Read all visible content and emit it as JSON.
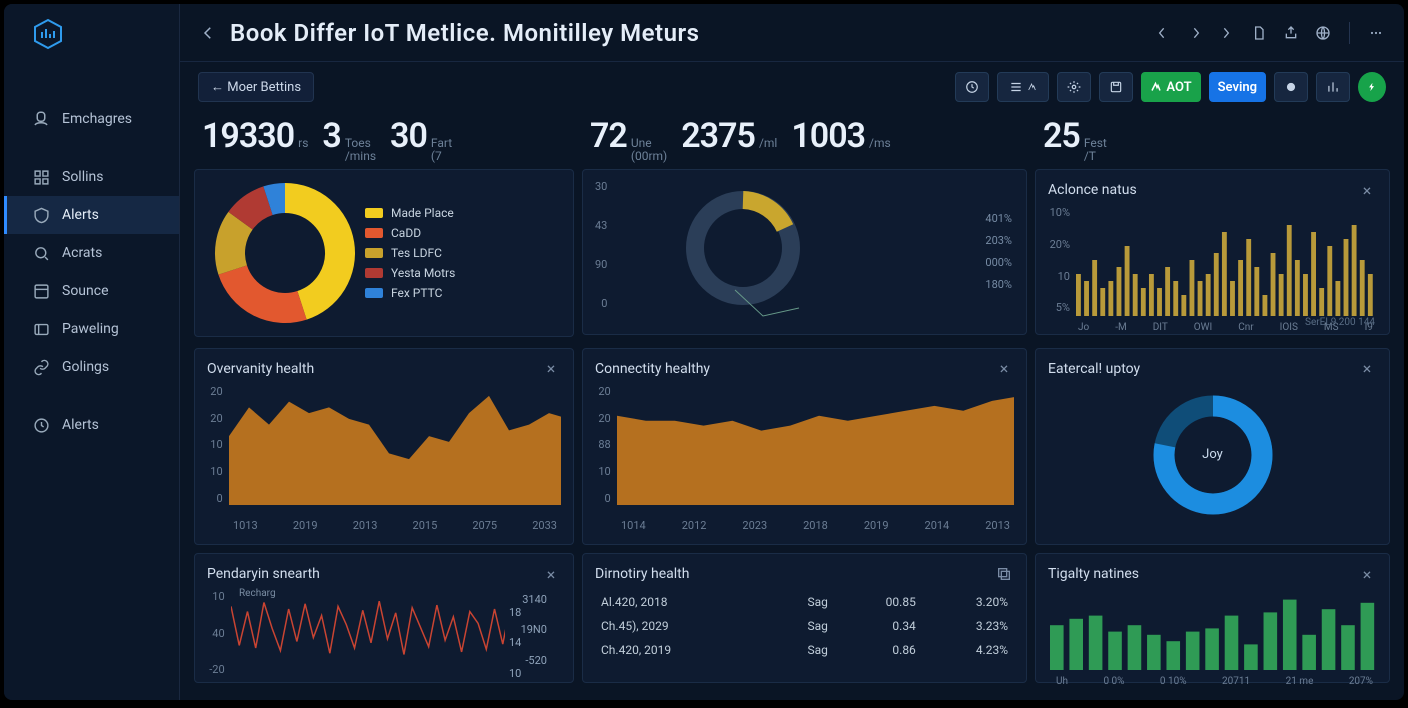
{
  "title": "Book Differ IoT Metlice. Monitilley Meturs",
  "crumb": "← Moer Bettins",
  "sidebar": {
    "header": "Emchagres",
    "items": [
      "Sollins",
      "Alerts",
      "Acrats",
      "Sounce",
      "Paweling",
      "Golings",
      "Alerts"
    ],
    "active": 1
  },
  "toolbar": {
    "btn_green": "AOT",
    "btn_blue": "Seving"
  },
  "kpi_left": [
    {
      "v": "19330",
      "u": "rs"
    },
    {
      "v": "3",
      "u1": "Toes",
      "u2": "/mins"
    },
    {
      "v": "30",
      "u1": "Fart",
      "u2": "(7"
    }
  ],
  "kpi_mid": [
    {
      "v": "72",
      "u1": "Une",
      "u2": "(00rm)"
    },
    {
      "v": "2375",
      "u": "/ml"
    },
    {
      "v": "1003",
      "u": "/ms"
    }
  ],
  "kpi_right": [
    {
      "v": "25",
      "u1": "Fest",
      "u2": "/T"
    }
  ],
  "donut1": {
    "legend": [
      {
        "label": "Made Place",
        "color": "#f2cc1f"
      },
      {
        "label": "CaDD",
        "color": "#e2582f"
      },
      {
        "label": "Tes LDFC",
        "color": "#c8a12c"
      },
      {
        "label": "Yesta Motrs",
        "color": "#b03a33"
      },
      {
        "label": "Fex PTTC",
        "color": "#2f82d9"
      }
    ],
    "slices": [
      45,
      25,
      15,
      10,
      5
    ]
  },
  "mid_chart": {
    "y": [
      "30",
      "43",
      "90",
      "0"
    ],
    "stats": [
      "401%",
      "203%",
      "000%",
      "180%"
    ]
  },
  "chart_data": [
    {
      "id": "overvanity",
      "type": "area",
      "title": "Overvanity health",
      "y_ticks": [
        20,
        20,
        10,
        10,
        0
      ],
      "x_ticks": [
        "1013",
        "2019",
        "2013",
        "2015",
        "2075",
        "2033"
      ],
      "values": [
        12,
        17,
        14,
        18,
        16,
        17,
        15,
        14,
        9,
        8,
        12,
        11,
        16,
        19,
        13,
        14,
        16,
        15
      ]
    },
    {
      "id": "connectity",
      "type": "area",
      "title": "Connectity healthy",
      "y_ticks": [
        20,
        20,
        "88",
        10,
        0
      ],
      "x_ticks": [
        "1014",
        "2012",
        "2023",
        "2018",
        "2019",
        "2014",
        "2013"
      ],
      "values": [
        18,
        17,
        17,
        16,
        17,
        15,
        16,
        18,
        17,
        18,
        19,
        20,
        19,
        21,
        22
      ]
    },
    {
      "id": "aclonce",
      "type": "bar",
      "title": "Aclonce natus",
      "y_ticks": [
        "10%",
        "20%",
        "10",
        "5%"
      ],
      "x_ticks": [
        "Jo",
        "-M",
        "DIT",
        "OWI",
        "Cnr",
        "IOIS",
        "MS",
        "I9"
      ],
      "footer": "SerEL9 200 144",
      "values": [
        6,
        5,
        8,
        4,
        5,
        7,
        10,
        6,
        4,
        6,
        4,
        7,
        5,
        3,
        8,
        5,
        6,
        9,
        12,
        5,
        8,
        11,
        7,
        3,
        9,
        6,
        13,
        8,
        6,
        12,
        4,
        10,
        5,
        11,
        13,
        8,
        6
      ]
    },
    {
      "id": "pendary",
      "type": "line",
      "title": "Pendaryin snearth",
      "legend": "Recharg",
      "y_ticks": [
        10,
        40,
        -20
      ],
      "right_labels": [
        [
          "3140",
          "18"
        ],
        [
          "19N0",
          "14"
        ],
        [
          "-520",
          "10"
        ]
      ],
      "values": [
        22,
        -8,
        18,
        -10,
        25,
        5,
        -12,
        20,
        -5,
        24,
        -2,
        15,
        -14,
        22,
        8,
        -10,
        19,
        -6,
        26,
        -3,
        17,
        -15,
        21,
        6,
        -9,
        23,
        -4,
        14,
        -13,
        18,
        9,
        -11,
        20,
        -7,
        25
      ]
    },
    {
      "id": "eatercall",
      "type": "donut",
      "title": "Eatercal! uptoy",
      "center": "Joy",
      "values": [
        78,
        22
      ],
      "colors": [
        "#1c8de0",
        "#0f4d78"
      ]
    },
    {
      "id": "tigalty",
      "type": "bar",
      "title": "Tigalty natines",
      "x_ticks": [
        "Uh",
        "0 0%",
        "0 10%",
        "20711",
        "21 me",
        "207%"
      ],
      "values": [
        14,
        16,
        17,
        12,
        14,
        11,
        9,
        12,
        13,
        17,
        8,
        18,
        22,
        11,
        19,
        14,
        21
      ]
    }
  ],
  "dirnotiry": {
    "title": "Dirnotiry health",
    "rows": [
      {
        "a": "Al.420, 2018",
        "b": "Sag",
        "c": "00.85",
        "d": "3.20%"
      },
      {
        "a": "Ch.45), 2029",
        "b": "Sag",
        "c": "0.34",
        "d": "3.23%"
      },
      {
        "a": "Ch.420, 2019",
        "b": "Sag",
        "c": "0.86",
        "d": "4.23%"
      }
    ]
  }
}
